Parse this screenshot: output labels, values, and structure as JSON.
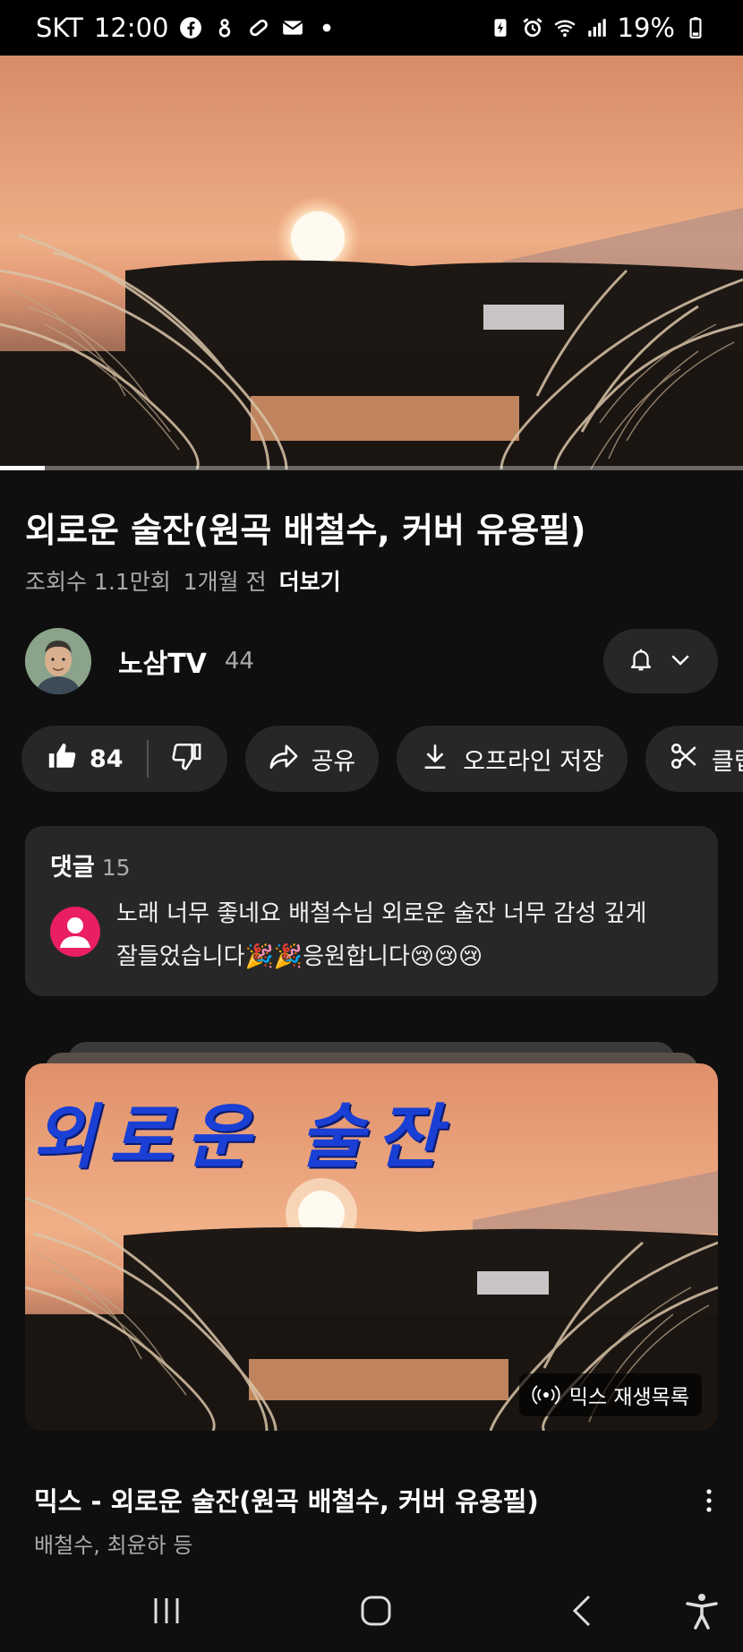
{
  "status_bar": {
    "carrier": "SKT",
    "time": "12:00",
    "battery": "19%",
    "icons_left": [
      "facebook-icon",
      "notification-icon",
      "tag-icon",
      "mail-icon",
      "dot-icon"
    ],
    "icons_right": [
      "battery-saver-icon",
      "alarm-icon",
      "wifi-icon",
      "signal-icon",
      "battery-icon"
    ]
  },
  "player": {
    "progress_fraction": 0.06
  },
  "video": {
    "title": "외로운 술잔(원곡 배철수, 커버 유용필)",
    "views": "조회수 1.1만회",
    "age": "1개월 전",
    "more_label": "더보기"
  },
  "channel": {
    "name": "노삼TV",
    "subscribers": "44"
  },
  "actions": {
    "like_count": "84",
    "share_label": "공유",
    "download_label": "오프라인 저장",
    "clip_label": "클립"
  },
  "comments": {
    "label": "댓글",
    "count": "15",
    "top_comment": "노래 너무 좋네요 배철수님 외로운 술잔 너무 감성 깊게 잘들었습니다🎉🎉응원합니다😢😢😢"
  },
  "mix": {
    "overlay_text": "외로운 술잔",
    "badge_label": "믹스 재생목록",
    "title": "믹스 - 외로운 술잔(원곡 배철수, 커버 유용필)",
    "subtitle": "배철수, 최윤하 등"
  },
  "colors": {
    "background": "#0f0f0f",
    "surface": "#272727",
    "text_secondary": "#aaaaaa",
    "sunset_sky": "#e8a57a",
    "comment_avatar": "#e91e63"
  }
}
